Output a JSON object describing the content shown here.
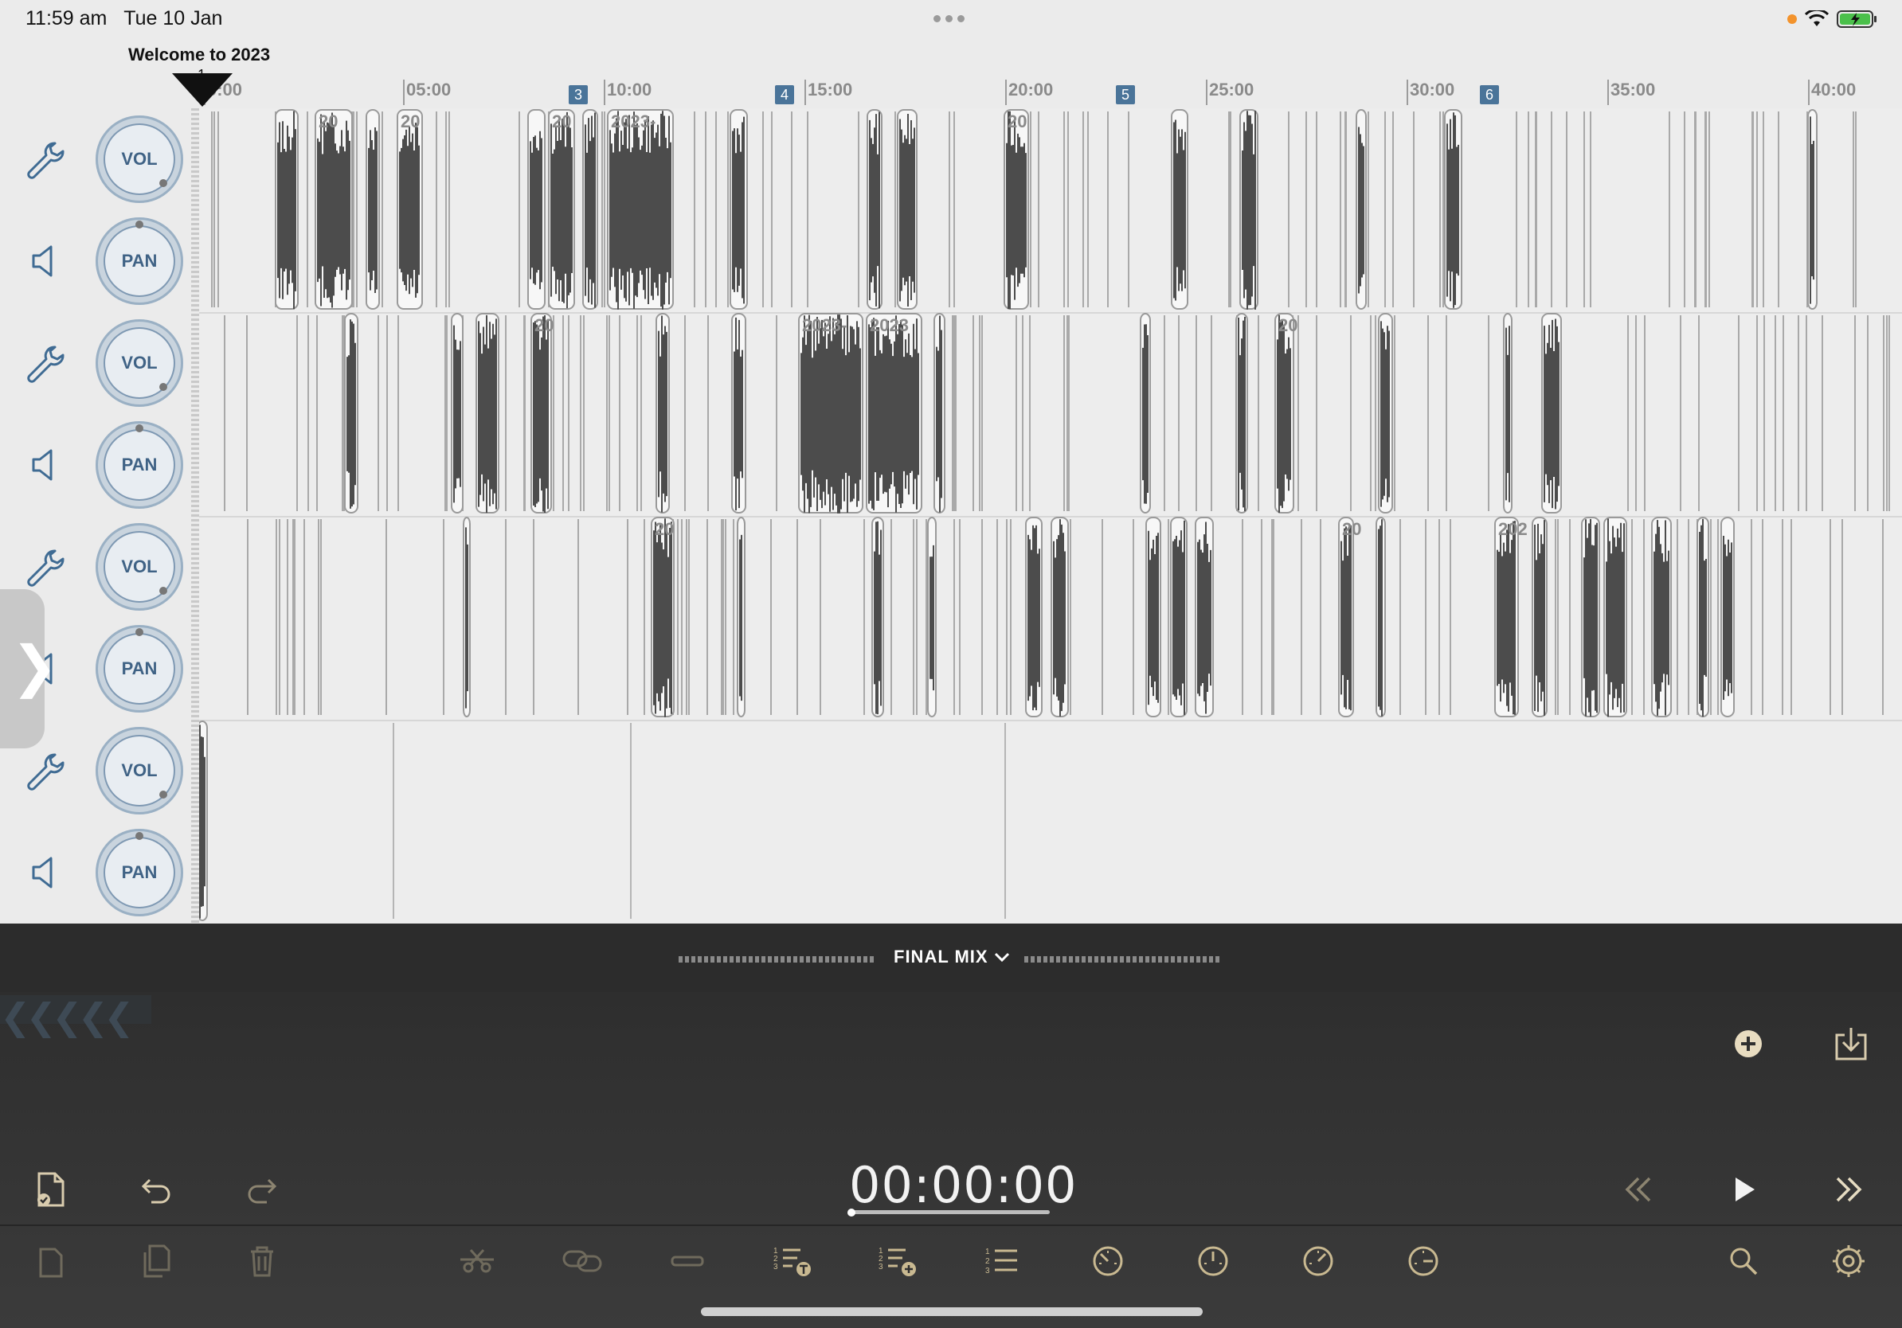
{
  "status_bar": {
    "time": "11:59 am",
    "date": "Tue 10 Jan"
  },
  "project": {
    "title": "Welcome to 2023"
  },
  "playhead": {
    "marker_number": "1"
  },
  "markers": [
    "3",
    "4",
    "5",
    "6"
  ],
  "ruler": {
    "ticks": [
      "0:00",
      "05:00",
      "10:00",
      "15:00",
      "20:00",
      "25:00",
      "30:00",
      "35:00",
      "40:00"
    ]
  },
  "tracks": [
    {
      "vol_label": "VOL",
      "pan_label": "PAN"
    },
    {
      "vol_label": "VOL",
      "pan_label": "PAN"
    },
    {
      "vol_label": "VOL",
      "pan_label": "PAN"
    },
    {
      "vol_label": "VOL",
      "pan_label": "PAN"
    }
  ],
  "clip_labels": {
    "t1": [
      "20",
      "20",
      "20",
      "2023-",
      "20"
    ],
    "t2": [
      "20",
      "2023-",
      "2023",
      "20"
    ],
    "t3": [
      "20",
      "20",
      "202"
    ]
  },
  "mix": {
    "title": "FINAL MIX"
  },
  "transport": {
    "timecode": "00:00:00"
  },
  "colors": {
    "accent_blue": "#4a7499",
    "knob_blue": "#3f6285",
    "toolbar_icon": "#c9b991",
    "dark_bg": "#2c2c2c"
  },
  "icons": {
    "left_tools": [
      "wrench-icon",
      "speaker-icon"
    ],
    "toolbar_row1": [
      "document-check-icon",
      "undo-icon",
      "redo-icon",
      "rewind-icon",
      "play-icon",
      "fast-forward-icon",
      "add-icon",
      "import-icon"
    ],
    "toolbar_row2": [
      "copy-icon",
      "paste-icon",
      "trash-icon",
      "split-icon",
      "link-icon",
      "trim-icon",
      "numbered-list-text-icon",
      "numbered-list-add-icon",
      "numbered-list-icon",
      "gauge-1-icon",
      "gauge-2-icon",
      "gauge-3-icon",
      "gauge-4-icon",
      "search-icon",
      "settings-icon"
    ]
  }
}
